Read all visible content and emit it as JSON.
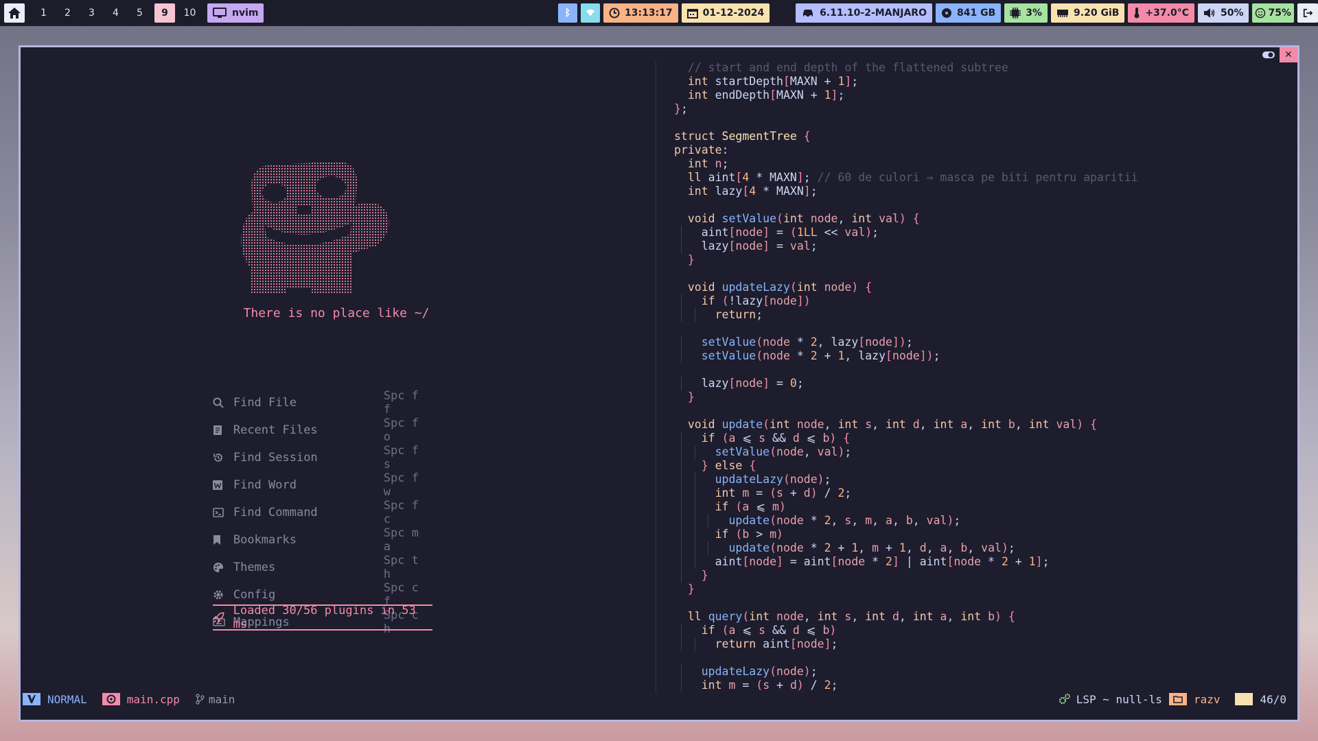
{
  "topbar": {
    "workspaces": [
      "1",
      "2",
      "3",
      "4",
      "5",
      "9",
      "10"
    ],
    "active_workspace": "9",
    "app_name": "nvim",
    "time": "13:13:17",
    "date": "01-12-2024",
    "kernel": "6.11.10-2-MANJARO",
    "disk": "841 GB",
    "cpu": "3%",
    "memory": "9.20 GiB",
    "temperature": "+37.0°C",
    "volume": "50%",
    "battery": "75%",
    "colors": {
      "bluetooth": "#89b4fa",
      "wifi": "#89dceb",
      "clock": "#fab387",
      "date": "#f9e2af",
      "kernel": "#b4befe",
      "disk": "#89b4fa",
      "cpu": "#a6e3a1",
      "memory": "#f9e2af",
      "temp": "#f38ba8",
      "volume": "#cdd6f4",
      "battery": "#a6e3a1"
    }
  },
  "dashboard": {
    "tagline": "There is no place like ~/",
    "menu": [
      {
        "icon": "search-icon",
        "label": "Find File",
        "key": "Spc f f"
      },
      {
        "icon": "file-icon",
        "label": "Recent Files",
        "key": "Spc f o"
      },
      {
        "icon": "history-icon",
        "label": "Find Session",
        "key": "Spc f s"
      },
      {
        "icon": "word-icon",
        "label": "Find Word",
        "key": "Spc f w"
      },
      {
        "icon": "terminal-icon",
        "label": "Find Command",
        "key": "Spc f c"
      },
      {
        "icon": "bookmark-icon",
        "label": "Bookmarks",
        "key": "Spc m a"
      },
      {
        "icon": "palette-icon",
        "label": "Themes",
        "key": "Spc t h"
      },
      {
        "icon": "gear-icon",
        "label": "Config",
        "key": "Spc c f"
      },
      {
        "icon": "keyboard-icon",
        "label": "Mappings",
        "key": "Spc c h"
      }
    ],
    "loaded": "Loaded 30/56 plugins in 53 ms"
  },
  "code_lines": [
    "  // start and end depth of the flattened subtree",
    "  int startDepth[MAXN + 1];",
    "  int endDepth[MAXN + 1];",
    "};",
    "",
    "struct SegmentTree {",
    "private:",
    "  int n;",
    "  ll aint[4 * MAXN]; // 60 de culori ⇒ masca pe biti pentru aparitii",
    "  int lazy[4 * MAXN];",
    "",
    "  void setValue(int node, int val) {",
    "    aint[node] = (1LL << val);",
    "    lazy[node] = val;",
    "  }",
    "",
    "  void updateLazy(int node) {",
    "    if (!lazy[node])",
    "      return;",
    "",
    "    setValue(node * 2, lazy[node]);",
    "    setValue(node * 2 + 1, lazy[node]);",
    "",
    "    lazy[node] = 0;",
    "  }",
    "",
    "  void update(int node, int s, int d, int a, int b, int val) {",
    "    if (a ⩽ s && d ⩽ b) {",
    "      setValue(node, val);",
    "    } else {",
    "      updateLazy(node);",
    "      int m = (s + d) / 2;",
    "      if (a ⩽ m)",
    "        update(node * 2, s, m, a, b, val);",
    "      if (b > m)",
    "        update(node * 2 + 1, m + 1, d, a, b, val);",
    "      aint[node] = aint[node * 2] | aint[node * 2 + 1];",
    "    }",
    "  }",
    "",
    "  ll query(int node, int s, int d, int a, int b) {",
    "    if (a ⩽ s && d ⩽ b)",
    "      return aint[node];",
    "",
    "    updateLazy(node);",
    "    int m = (s + d) / 2;"
  ],
  "statusline": {
    "mode": "NORMAL",
    "file": "main.cpp",
    "branch": "main",
    "lsp": "LSP ~ null-ls",
    "folder": "razv",
    "position": "46/0",
    "colors": {
      "mode": "#89b4fa",
      "file": "#f38ba8",
      "folder": "#fab387",
      "position": "#f9e2af"
    }
  }
}
